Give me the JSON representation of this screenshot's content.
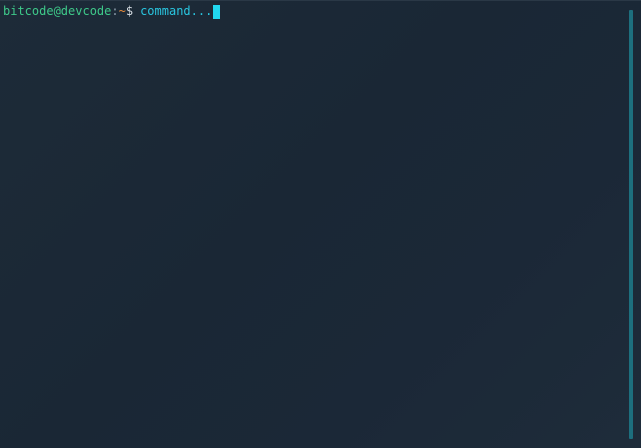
{
  "terminal": {
    "prompt": {
      "user_host": "bitcode@devcode",
      "separator": ":",
      "path": "~",
      "symbol": "$"
    },
    "input": {
      "value": "command..."
    },
    "colors": {
      "background": "#1a2735",
      "user_host": "#3ec98a",
      "path": "#e88b3a",
      "input": "#29c6e0",
      "cursor": "#21d8f0",
      "scrollbar": "#1d6f7e"
    }
  }
}
